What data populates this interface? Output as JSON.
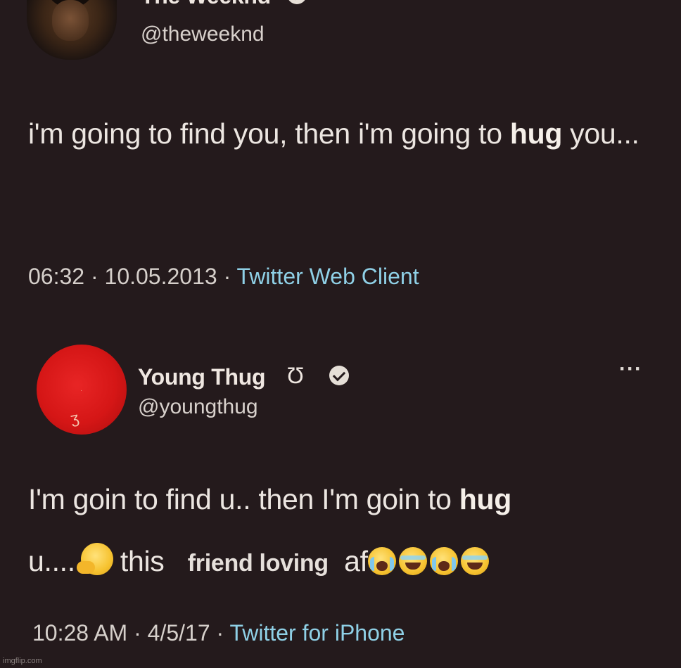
{
  "tweets": [
    {
      "name": "The Weeknd",
      "handle": "@theweeknd",
      "text_parts": [
        "i'm going to find you, then i'm going to ",
        "hug",
        " you..."
      ],
      "time": "06:32",
      "date": "10.05.2013",
      "separator": "·",
      "source": "Twitter Web Client",
      "more": "···",
      "verified": true
    },
    {
      "name": "Young Thug",
      "symbol": "Ʊ",
      "handle": "@youngthug",
      "text_parts": [
        "I'm goin to find u.. then I'm goin to ",
        "hug",
        " u....",
        "this",
        "friend loving",
        "af"
      ],
      "emoji": [
        "thinking-face",
        "loudly-crying-face",
        "face-with-tears-of-joy",
        "loudly-crying-face",
        "face-with-tears-of-joy"
      ],
      "time": "10:28 AM",
      "date": "4/5/17",
      "separator": "·",
      "source": "Twitter for iPhone",
      "more": "···",
      "verified": true,
      "avatar_color": "#d51616"
    }
  ],
  "watermark": "imgflip.com",
  "colors": {
    "background": "#241a1c",
    "text": "#ece6e1",
    "link": "#8fd0e6"
  }
}
